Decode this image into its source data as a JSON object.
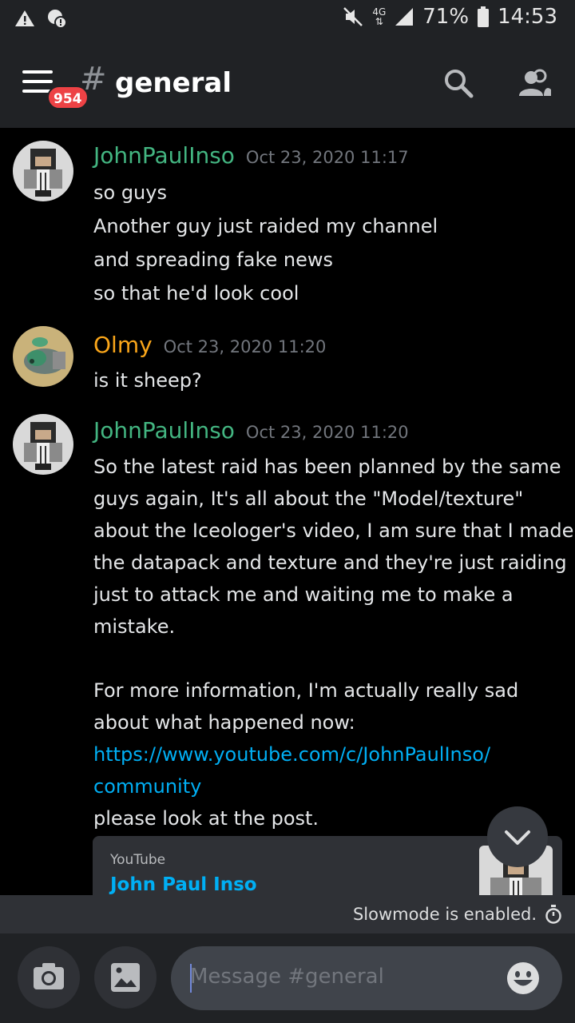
{
  "status_bar": {
    "network": "4G",
    "battery": "71%",
    "time": "14:53"
  },
  "header": {
    "badge_count": "954",
    "hash": "#",
    "channel": "general"
  },
  "messages": [
    {
      "author": "JohnPaulInso",
      "author_color": "#43b581",
      "timestamp": "Oct 23, 2020 11:17",
      "lines": [
        "so guys",
        "Another guy just raided my channel",
        "and spreading fake news",
        "so that he'd look cool"
      ]
    },
    {
      "author": "Olmy",
      "author_color": "#faa61a",
      "timestamp": "Oct 23, 2020 11:20",
      "lines": [
        "is it sheep?"
      ]
    },
    {
      "author": "JohnPaulInso",
      "author_color": "#43b581",
      "timestamp": "Oct 23, 2020 11:20",
      "lines": [
        "So the latest raid has been planned by the same",
        "guys again, It's all about the \"Model/texture\"",
        "about the Iceologer's video, I am sure that I made",
        "the datapack and texture and they're just raiding",
        "just to attack me and waiting me to make a",
        "mistake.",
        "For more information, I'm actually really sad",
        "about what happened now:",
        "https://www.youtube.com/c/JohnPaulInso/",
        "community",
        "please look at the post."
      ],
      "embed": {
        "provider": "YouTube",
        "title": "John Paul Inso"
      }
    }
  ],
  "slowmode": {
    "text": "Slowmode is enabled."
  },
  "composer": {
    "placeholder": "Message #general"
  },
  "colors": {
    "background": "#000000",
    "header": "#202225",
    "link": "#00aff4",
    "badge": "#ed4245"
  }
}
